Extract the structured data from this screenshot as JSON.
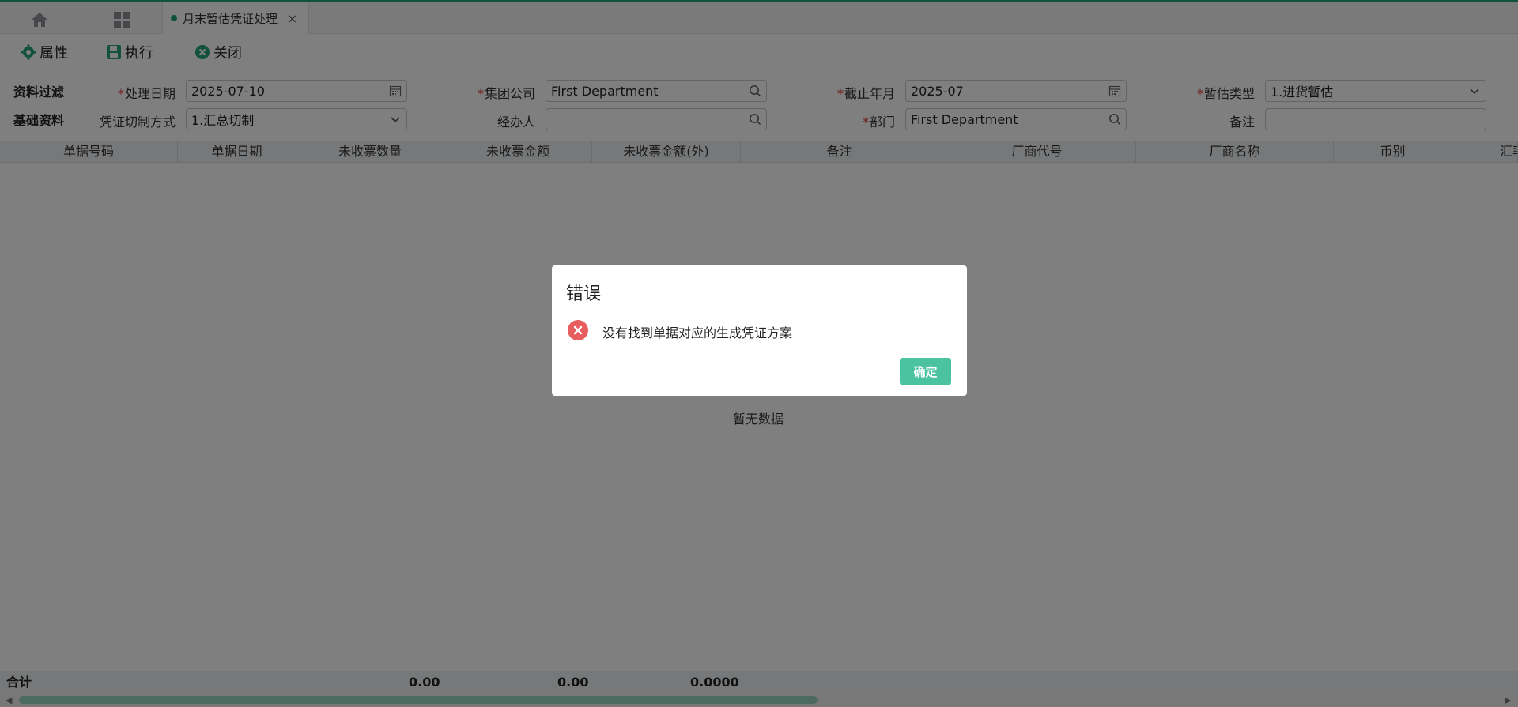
{
  "tabs": {
    "active_label": "月末暂估凭证处理",
    "close_glyph": "×"
  },
  "toolbar": {
    "properties_label": "属性",
    "execute_label": "执行",
    "close_label": "关闭"
  },
  "filters": {
    "section_data_filter": "资料过滤",
    "section_basic_data": "基础资料",
    "process_date": {
      "label": "处理日期",
      "value": "2025-07-10",
      "required": true
    },
    "group_company": {
      "label": "集团公司",
      "value": "First Department",
      "required": true
    },
    "cutoff_month": {
      "label": "截止年月",
      "value": "2025-07",
      "required": true
    },
    "estimate_type": {
      "label": "暂估类型",
      "value": "1.进货暂估",
      "required": true
    },
    "voucher_split": {
      "label": "凭证切制方式",
      "value": "1.汇总切制",
      "required": false
    },
    "handler": {
      "label": "经办人",
      "value": "",
      "required": false
    },
    "department": {
      "label": "部门",
      "value": "First Department",
      "required": true
    },
    "remark": {
      "label": "备注",
      "value": "",
      "required": false
    },
    "required_mark": "*"
  },
  "grid": {
    "columns": [
      "单据号码",
      "单据日期",
      "未收票数量",
      "未收票金额",
      "未收票金额(外)",
      "备注",
      "厂商代号",
      "厂商名称",
      "币别",
      "汇率"
    ],
    "empty_text": "暂无数据",
    "footer": {
      "label": "合计",
      "qty_total": "0.00",
      "amount_total": "0.00",
      "amount_foreign_total": "0.0000"
    }
  },
  "dialog": {
    "title": "错误",
    "message": "没有找到单据对应的生成凭证方案",
    "ok_label": "确定"
  },
  "colors": {
    "accent": "#22a27a",
    "ok_button": "#4bc3a0",
    "error_icon": "#e85d5d",
    "required": "#e0302b"
  }
}
